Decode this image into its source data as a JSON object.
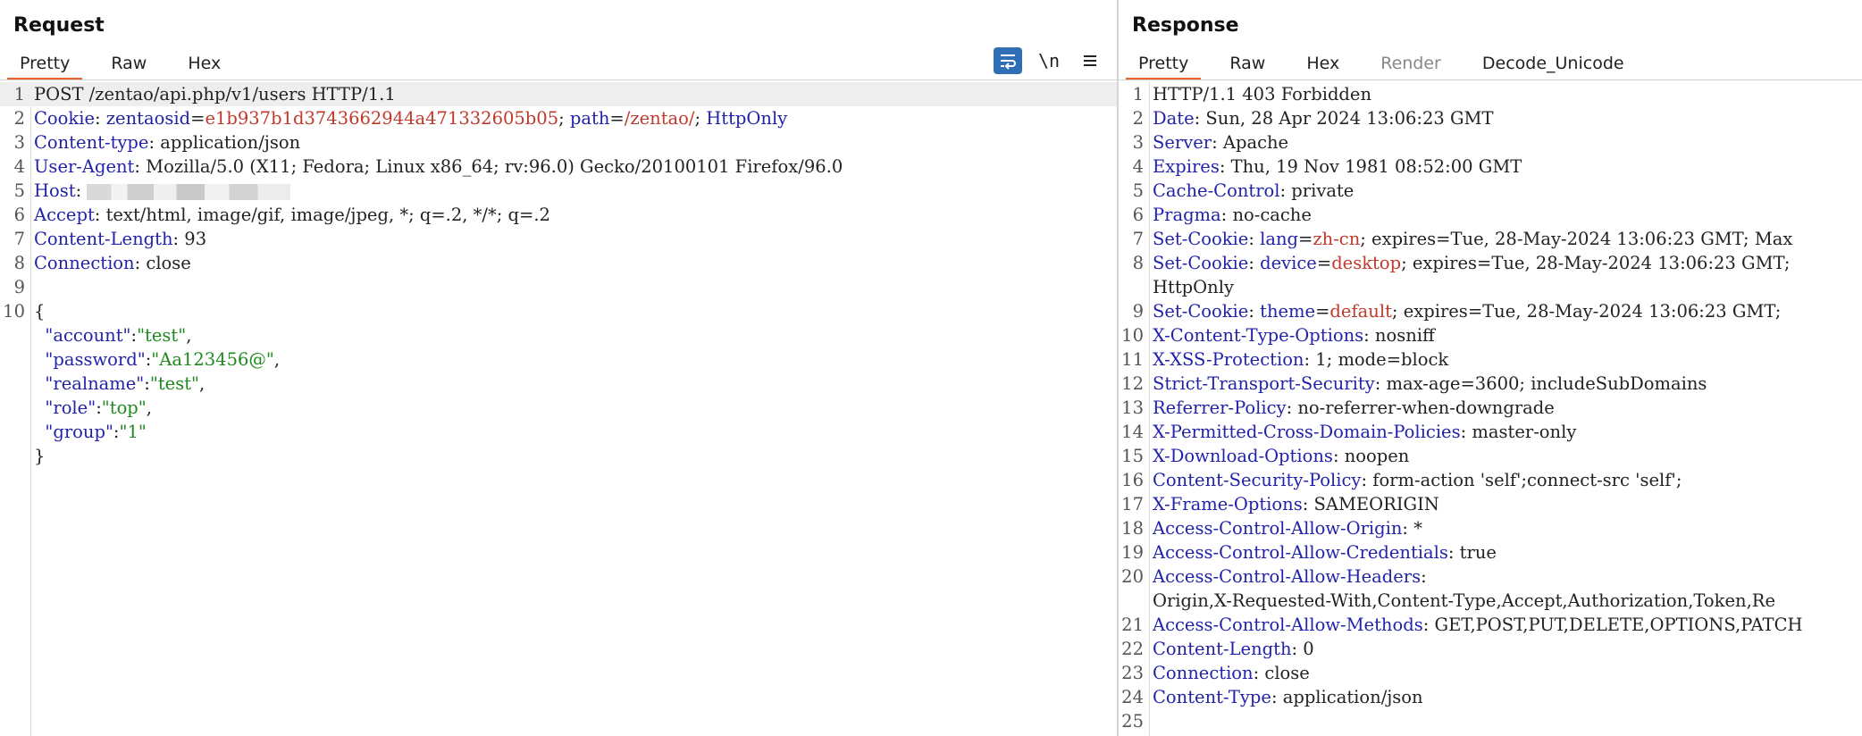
{
  "request": {
    "title": "Request",
    "tabs": [
      "Pretty",
      "Raw",
      "Hex"
    ],
    "toolbar": {
      "wrap_icon": "wrap-lines-icon",
      "newline_label": "\\n",
      "menu_icon": "menu-icon"
    },
    "lines": [
      {
        "n": "1",
        "parts": [
          {
            "t": "POST /zentao/api.php/v1/users HTTP/1.1",
            "c": ""
          }
        ]
      },
      {
        "n": "2",
        "parts": [
          {
            "t": "Cookie",
            "c": "k"
          },
          {
            "t": ": ",
            "c": ""
          },
          {
            "t": "zentaosid",
            "c": "k"
          },
          {
            "t": "=",
            "c": ""
          },
          {
            "t": "e1b937b1d3743662944a471332605b05",
            "c": "v"
          },
          {
            "t": "; ",
            "c": ""
          },
          {
            "t": "path",
            "c": "k"
          },
          {
            "t": "=",
            "c": ""
          },
          {
            "t": "/zentao/",
            "c": "v"
          },
          {
            "t": "; ",
            "c": ""
          },
          {
            "t": "HttpOnly",
            "c": "k"
          }
        ]
      },
      {
        "n": "3",
        "parts": [
          {
            "t": "Content-type",
            "c": "k"
          },
          {
            "t": ": application/json",
            "c": ""
          }
        ]
      },
      {
        "n": "4",
        "parts": [
          {
            "t": "User-Agent",
            "c": "k"
          },
          {
            "t": ": Mozilla/5.0 (X11; Fedora; Linux x86_64; rv:96.0) Gecko/20100101 Firefox/96.0",
            "c": ""
          }
        ]
      },
      {
        "n": "5",
        "parts": [
          {
            "t": "Host",
            "c": "k"
          },
          {
            "t": ": ",
            "c": ""
          },
          {
            "t": "",
            "c": "blur"
          }
        ]
      },
      {
        "n": "6",
        "parts": [
          {
            "t": "Accept",
            "c": "k"
          },
          {
            "t": ": text/html, image/gif, image/jpeg, *; q=.2, */*; q=.2",
            "c": ""
          }
        ]
      },
      {
        "n": "7",
        "parts": [
          {
            "t": "Content-Length",
            "c": "k"
          },
          {
            "t": ": 93",
            "c": ""
          }
        ]
      },
      {
        "n": "8",
        "parts": [
          {
            "t": "Connection",
            "c": "k"
          },
          {
            "t": ": close",
            "c": ""
          }
        ]
      },
      {
        "n": "9",
        "parts": []
      },
      {
        "n": "10",
        "parts": [
          {
            "t": "{",
            "c": ""
          }
        ]
      },
      {
        "n": "",
        "parts": [
          {
            "t": "  \"account\"",
            "c": "k"
          },
          {
            "t": ":",
            "c": ""
          },
          {
            "t": "\"test\"",
            "c": "s"
          },
          {
            "t": ",",
            "c": ""
          }
        ]
      },
      {
        "n": "",
        "parts": [
          {
            "t": "  \"password\"",
            "c": "k"
          },
          {
            "t": ":",
            "c": ""
          },
          {
            "t": "\"Aa123456@\"",
            "c": "s"
          },
          {
            "t": ",",
            "c": ""
          }
        ]
      },
      {
        "n": "",
        "parts": [
          {
            "t": "  \"realname\"",
            "c": "k"
          },
          {
            "t": ":",
            "c": ""
          },
          {
            "t": "\"test\"",
            "c": "s"
          },
          {
            "t": ",",
            "c": ""
          }
        ]
      },
      {
        "n": "",
        "parts": [
          {
            "t": "  \"role\"",
            "c": "k"
          },
          {
            "t": ":",
            "c": ""
          },
          {
            "t": "\"top\"",
            "c": "s"
          },
          {
            "t": ",",
            "c": ""
          }
        ]
      },
      {
        "n": "",
        "parts": [
          {
            "t": "  \"group\"",
            "c": "k"
          },
          {
            "t": ":",
            "c": ""
          },
          {
            "t": "\"1\"",
            "c": "s"
          }
        ]
      },
      {
        "n": "",
        "parts": [
          {
            "t": "}",
            "c": ""
          }
        ]
      }
    ]
  },
  "response": {
    "title": "Response",
    "tabs": [
      "Pretty",
      "Raw",
      "Hex",
      "Render",
      "Decode_Unicode"
    ],
    "lines": [
      {
        "n": "1",
        "parts": [
          {
            "t": "HTTP/1.1 403 Forbidden",
            "c": ""
          }
        ]
      },
      {
        "n": "2",
        "parts": [
          {
            "t": "Date",
            "c": "k"
          },
          {
            "t": ": Sun, 28 Apr 2024 13:06:23 GMT",
            "c": ""
          }
        ]
      },
      {
        "n": "3",
        "parts": [
          {
            "t": "Server",
            "c": "k"
          },
          {
            "t": ": Apache",
            "c": ""
          }
        ]
      },
      {
        "n": "4",
        "parts": [
          {
            "t": "Expires",
            "c": "k"
          },
          {
            "t": ": Thu, 19 Nov 1981 08:52:00 GMT",
            "c": ""
          }
        ]
      },
      {
        "n": "5",
        "parts": [
          {
            "t": "Cache-Control",
            "c": "k"
          },
          {
            "t": ": private",
            "c": ""
          }
        ]
      },
      {
        "n": "6",
        "parts": [
          {
            "t": "Pragma",
            "c": "k"
          },
          {
            "t": ": no-cache",
            "c": ""
          }
        ]
      },
      {
        "n": "7",
        "parts": [
          {
            "t": "Set-Cookie",
            "c": "k"
          },
          {
            "t": ": ",
            "c": ""
          },
          {
            "t": "lang",
            "c": "k"
          },
          {
            "t": "=",
            "c": ""
          },
          {
            "t": "zh-cn",
            "c": "v"
          },
          {
            "t": "; expires=Tue, 28-May-2024 13:06:23 GMT; Max",
            "c": ""
          }
        ]
      },
      {
        "n": "8",
        "parts": [
          {
            "t": "Set-Cookie",
            "c": "k"
          },
          {
            "t": ": ",
            "c": ""
          },
          {
            "t": "device",
            "c": "k"
          },
          {
            "t": "=",
            "c": ""
          },
          {
            "t": "desktop",
            "c": "v"
          },
          {
            "t": "; expires=Tue, 28-May-2024 13:06:23 GMT;",
            "c": ""
          }
        ]
      },
      {
        "n": "",
        "parts": [
          {
            "t": "HttpOnly",
            "c": ""
          }
        ]
      },
      {
        "n": "9",
        "parts": [
          {
            "t": "Set-Cookie",
            "c": "k"
          },
          {
            "t": ": ",
            "c": ""
          },
          {
            "t": "theme",
            "c": "k"
          },
          {
            "t": "=",
            "c": ""
          },
          {
            "t": "default",
            "c": "v"
          },
          {
            "t": "; expires=Tue, 28-May-2024 13:06:23 GMT;",
            "c": ""
          }
        ]
      },
      {
        "n": "10",
        "parts": [
          {
            "t": "X-Content-Type-Options",
            "c": "k"
          },
          {
            "t": ": nosniff",
            "c": ""
          }
        ]
      },
      {
        "n": "11",
        "parts": [
          {
            "t": "X-XSS-Protection",
            "c": "k"
          },
          {
            "t": ": 1; mode=block",
            "c": ""
          }
        ]
      },
      {
        "n": "12",
        "parts": [
          {
            "t": "Strict-Transport-Security",
            "c": "k"
          },
          {
            "t": ": max-age=3600; includeSubDomains",
            "c": ""
          }
        ]
      },
      {
        "n": "13",
        "parts": [
          {
            "t": "Referrer-Policy",
            "c": "k"
          },
          {
            "t": ": no-referrer-when-downgrade",
            "c": ""
          }
        ]
      },
      {
        "n": "14",
        "parts": [
          {
            "t": "X-Permitted-Cross-Domain-Policies",
            "c": "k"
          },
          {
            "t": ": master-only",
            "c": ""
          }
        ]
      },
      {
        "n": "15",
        "parts": [
          {
            "t": "X-Download-Options",
            "c": "k"
          },
          {
            "t": ": noopen",
            "c": ""
          }
        ]
      },
      {
        "n": "16",
        "parts": [
          {
            "t": "Content-Security-Policy",
            "c": "k"
          },
          {
            "t": ": form-action 'self';connect-src 'self';",
            "c": ""
          }
        ]
      },
      {
        "n": "17",
        "parts": [
          {
            "t": "X-Frame-Options",
            "c": "k"
          },
          {
            "t": ": SAMEORIGIN",
            "c": ""
          }
        ]
      },
      {
        "n": "18",
        "parts": [
          {
            "t": "Access-Control-Allow-Origin",
            "c": "k"
          },
          {
            "t": ": *",
            "c": ""
          }
        ]
      },
      {
        "n": "19",
        "parts": [
          {
            "t": "Access-Control-Allow-Credentials",
            "c": "k"
          },
          {
            "t": ": true",
            "c": ""
          }
        ]
      },
      {
        "n": "20",
        "parts": [
          {
            "t": "Access-Control-Allow-Headers",
            "c": "k"
          },
          {
            "t": ":",
            "c": ""
          }
        ]
      },
      {
        "n": "",
        "parts": [
          {
            "t": "Origin,X-Requested-With,Content-Type,Accept,Authorization,Token,Re",
            "c": ""
          }
        ]
      },
      {
        "n": "21",
        "parts": [
          {
            "t": "Access-Control-Allow-Methods",
            "c": "k"
          },
          {
            "t": ": GET,POST,PUT,DELETE,OPTIONS,PATCH",
            "c": ""
          }
        ]
      },
      {
        "n": "22",
        "parts": [
          {
            "t": "Content-Length",
            "c": "k"
          },
          {
            "t": ": 0",
            "c": ""
          }
        ]
      },
      {
        "n": "23",
        "parts": [
          {
            "t": "Connection",
            "c": "k"
          },
          {
            "t": ": close",
            "c": ""
          }
        ]
      },
      {
        "n": "24",
        "parts": [
          {
            "t": "Content-Type",
            "c": "k"
          },
          {
            "t": ": application/json",
            "c": ""
          }
        ]
      },
      {
        "n": "25",
        "parts": []
      }
    ]
  },
  "colors": {
    "accent": "#e8602c",
    "key": "#2222aa",
    "value": "#c0392b",
    "string": "#1e8a1e",
    "toggle": "#2f6fb5"
  }
}
